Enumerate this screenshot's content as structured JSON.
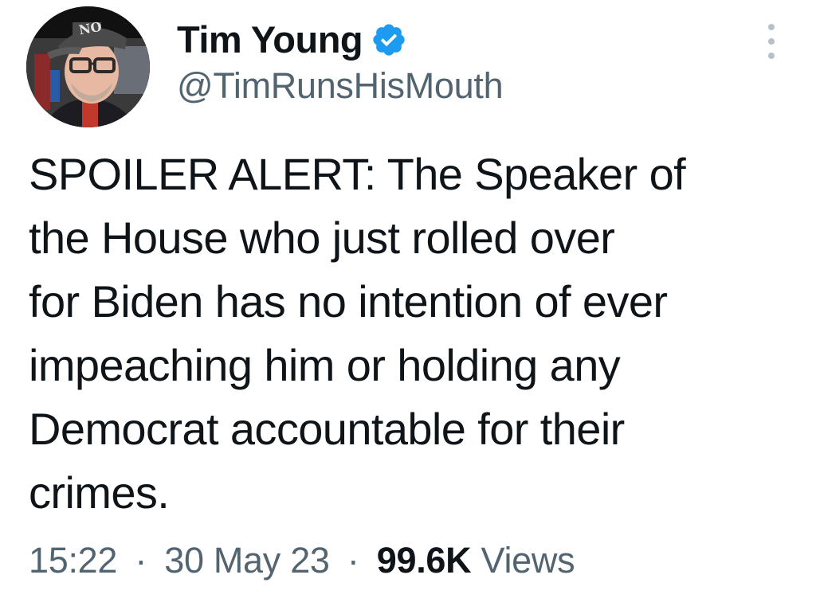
{
  "author": {
    "display_name": "Tim Young",
    "handle": "@TimRunsHisMouth",
    "verified": true,
    "avatar_cap_text": "NO"
  },
  "tweet": {
    "text": "SPOILER ALERT:  The Speaker of\nthe House who just rolled over\nfor Biden has no intention of ever\nimpeaching him or holding any\nDemocrat accountable for their\ncrimes."
  },
  "meta": {
    "time": "15:22",
    "separator": "·",
    "date": "30 May 23",
    "views_count": "99.6K",
    "views_label": "Views"
  },
  "colors": {
    "verified_badge": "#1d9bf0",
    "secondary_text": "#536471",
    "primary_text": "#0f1419"
  },
  "icons": {
    "verified": "verified-badge-icon",
    "more": "more-options-icon"
  }
}
